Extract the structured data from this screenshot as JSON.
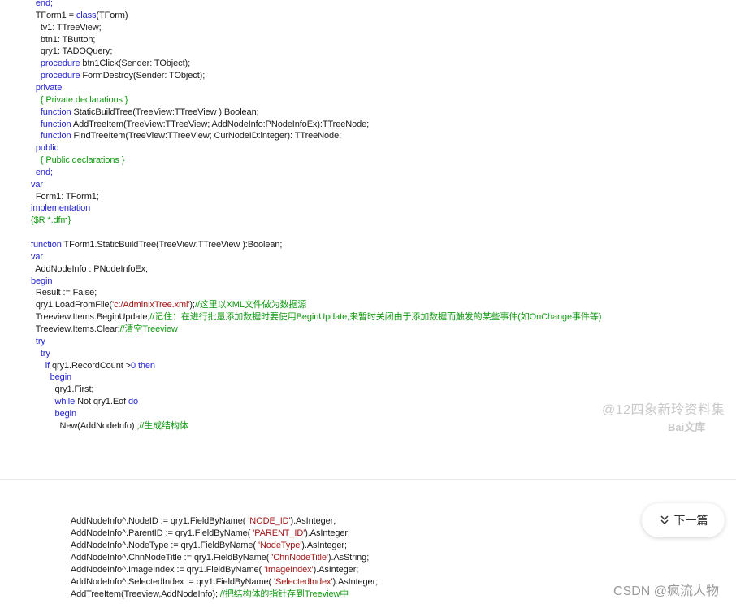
{
  "code_top": [
    [
      [
        "kw",
        "  end;"
      ]
    ],
    [
      [
        "tx",
        "  TForm1 = "
      ],
      [
        "kw",
        "class"
      ],
      [
        "tx",
        "(TForm)"
      ]
    ],
    [
      [
        "tx",
        "    tv1: TTreeView;"
      ]
    ],
    [
      [
        "tx",
        "    btn1: TButton;"
      ]
    ],
    [
      [
        "tx",
        "    qry1: TADOQuery;"
      ]
    ],
    [
      [
        "kw",
        "    procedure"
      ],
      [
        "tx",
        " btn1Click(Sender: TObject);"
      ]
    ],
    [
      [
        "kw",
        "    procedure"
      ],
      [
        "tx",
        " FormDestroy(Sender: TObject);"
      ]
    ],
    [
      [
        "kw",
        "  private"
      ]
    ],
    [
      [
        "cm",
        "    { Private declarations }"
      ]
    ],
    [
      [
        "kw",
        "    function"
      ],
      [
        "tx",
        " StaticBuildTree(TreeView:TTreeView ):Boolean;"
      ]
    ],
    [
      [
        "kw",
        "    function"
      ],
      [
        "tx",
        " AddTreeItem(TreeView:TTreeView; AddNodeInfo:PNodeInfoEx):TTreeNode;"
      ]
    ],
    [
      [
        "kw",
        "    function"
      ],
      [
        "tx",
        " FindTreeItem(TreeView:TTreeView; CurNodeID:integer): TTreeNode;"
      ]
    ],
    [
      [
        "kw",
        "  public"
      ]
    ],
    [
      [
        "cm",
        "    { Public declarations }"
      ]
    ],
    [
      [
        "kw",
        "  end;"
      ]
    ],
    [
      [
        "kw",
        "var"
      ]
    ],
    [
      [
        "tx",
        "  Form1: TForm1;"
      ]
    ],
    [
      [
        "kw",
        "implementation"
      ]
    ],
    [
      [
        "cm",
        "{$R *.dfm}"
      ]
    ],
    [
      [
        "tx",
        ""
      ]
    ],
    [
      [
        "kw",
        "function"
      ],
      [
        "tx",
        " TForm1.StaticBuildTree(TreeView:TTreeView ):Boolean;"
      ]
    ],
    [
      [
        "kw",
        "var"
      ]
    ],
    [
      [
        "tx",
        "  AddNodeInfo : PNodeInfoEx;"
      ]
    ],
    [
      [
        "kw",
        "begin"
      ]
    ],
    [
      [
        "tx",
        "  Result := False;"
      ]
    ],
    [
      [
        "tx",
        "  qry1.LoadFromFile("
      ],
      [
        "st",
        "'c:/AdminixTree.xml'"
      ],
      [
        "tx",
        ");"
      ],
      [
        "cm",
        "//这里以XML文件做为数据源"
      ]
    ],
    [
      [
        "tx",
        "  Treeview.Items.BeginUpdate;"
      ],
      [
        "cm",
        "//记住：在进行批量添加数据时要使用BeginUpdate,来暂时关闭由于添加数据而触发的某些事件(如OnChange事件等)"
      ]
    ],
    [
      [
        "tx",
        "  Treeview.Items.Clear;"
      ],
      [
        "cm",
        "//清空Treeview"
      ]
    ],
    [
      [
        "kw",
        "  try"
      ]
    ],
    [
      [
        "kw",
        "    try"
      ]
    ],
    [
      [
        "kw",
        "      if"
      ],
      [
        "tx",
        " qry1.RecordCount >"
      ],
      [
        "num",
        "0"
      ],
      [
        "kw",
        " then"
      ]
    ],
    [
      [
        "kw",
        "        begin"
      ]
    ],
    [
      [
        "tx",
        "          qry1.First;"
      ]
    ],
    [
      [
        "kw",
        "          while"
      ],
      [
        "tx",
        " Not qry1.Eof "
      ],
      [
        "kw",
        "do"
      ]
    ],
    [
      [
        "kw",
        "          begin"
      ]
    ],
    [
      [
        "tx",
        "            New(AddNodeInfo) ;"
      ],
      [
        "cm",
        "//生成结构体"
      ]
    ]
  ],
  "code_bottom": [
    [
      [
        "tx",
        "            AddNodeInfo^.NodeID := qry1.FieldByName( "
      ],
      [
        "st",
        "'NODE_ID'"
      ],
      [
        "tx",
        ").AsInteger;"
      ]
    ],
    [
      [
        "tx",
        "            AddNodeInfo^.ParentID := qry1.FieldByName( "
      ],
      [
        "st",
        "'PARENT_ID'"
      ],
      [
        "tx",
        ").AsInteger;"
      ]
    ],
    [
      [
        "tx",
        "            AddNodeInfo^.NodeType := qry1.FieldByName( "
      ],
      [
        "st",
        "'NodeType'"
      ],
      [
        "tx",
        ").AsInteger;"
      ]
    ],
    [
      [
        "tx",
        "            AddNodeInfo^.ChnNodeTitle := qry1.FieldByName( "
      ],
      [
        "st",
        "'ChnNodeTitle'"
      ],
      [
        "tx",
        ").AsString;"
      ]
    ],
    [
      [
        "tx",
        "            AddNodeInfo^.ImageIndex := qry1.FieldByName( "
      ],
      [
        "st",
        "'ImageIndex'"
      ],
      [
        "tx",
        ").AsInteger;"
      ]
    ],
    [
      [
        "tx",
        "            AddNodeInfo^.SelectedIndex := qry1.FieldByName( "
      ],
      [
        "st",
        "'SelectedIndex'"
      ],
      [
        "tx",
        ").AsInteger;"
      ]
    ],
    [
      [
        "tx",
        "            AddTreeItem(Treeview,AddNodeInfo); "
      ],
      [
        "cm",
        "//把结构体的指针存到Treeview中"
      ]
    ]
  ],
  "watermark": {
    "text": "@12四象新玲资料集",
    "logo": "Bai文库"
  },
  "next_button": {
    "label": "下一篇",
    "icon": "double-chevron-down-icon"
  },
  "footer_watermark": "CSDN @疯流人物",
  "colors": {
    "keyword": "#1f1fd6",
    "comment": "#119911",
    "string": "#a31515"
  }
}
